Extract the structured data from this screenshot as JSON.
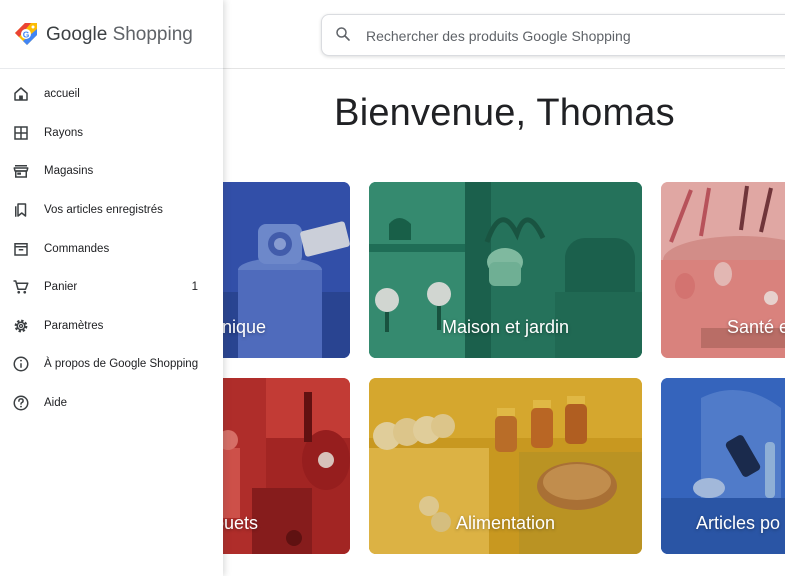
{
  "brand": {
    "google": "Google",
    "shopping": "Shopping"
  },
  "search": {
    "placeholder": "Rechercher des produits Google Shopping",
    "value": ""
  },
  "welcome": "Bienvenue, Thomas",
  "sidebar": {
    "items": [
      {
        "label": "accueil",
        "icon": "home-icon"
      },
      {
        "label": "Rayons",
        "icon": "grid-icon"
      },
      {
        "label": "Magasins",
        "icon": "store-icon"
      },
      {
        "label": "Vos articles enregistrés",
        "icon": "bookmark-icon"
      },
      {
        "label": "Commandes",
        "icon": "orders-icon"
      },
      {
        "label": "Panier",
        "icon": "cart-icon",
        "count": "1"
      },
      {
        "label": "Paramètres",
        "icon": "gear-icon"
      },
      {
        "label": "À propos de Google Shopping",
        "icon": "info-icon"
      },
      {
        "label": "Aide",
        "icon": "help-icon"
      }
    ]
  },
  "categories": [
    {
      "label": "nique"
    },
    {
      "label": "Maison et jardin"
    },
    {
      "label": "Santé e"
    },
    {
      "label": "ouets"
    },
    {
      "label": "Alimentation"
    },
    {
      "label": "Articles po"
    }
  ],
  "colors": {
    "electronics": "#3655b8",
    "home_garden": "#2c8a6f",
    "health": "#f1b2ad",
    "toys": "#d5403a",
    "food": "#e7b431",
    "sports": "#3a6fd0"
  }
}
